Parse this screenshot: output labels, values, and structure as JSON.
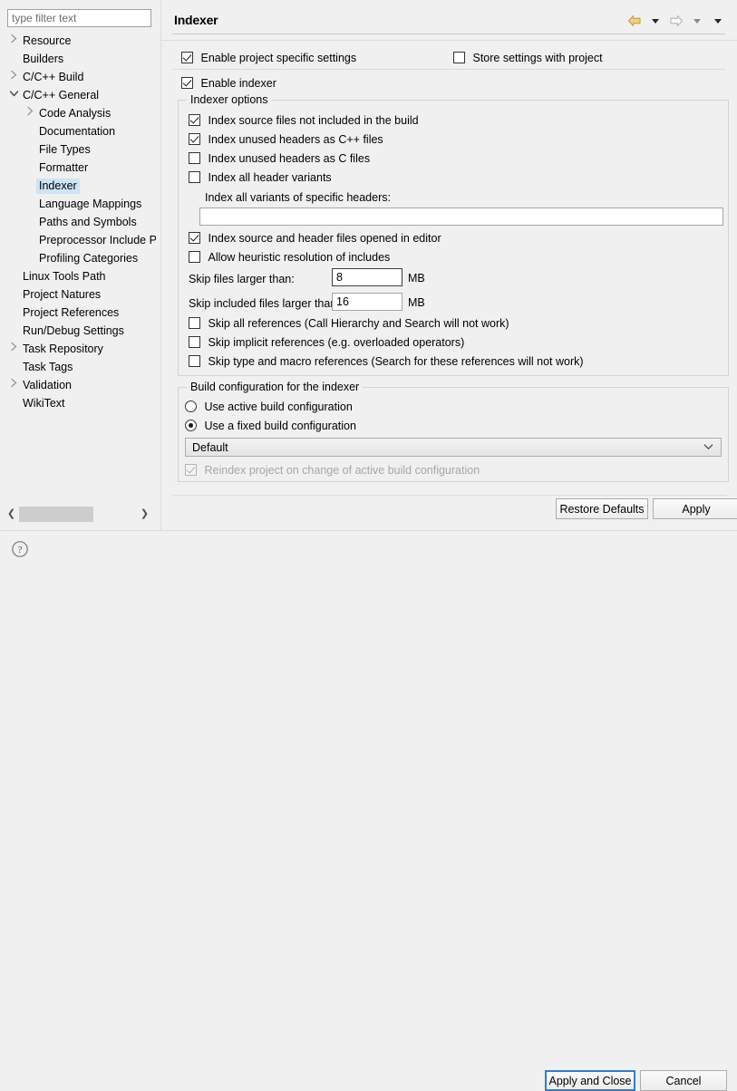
{
  "window": {
    "title": "Indexer"
  },
  "sidebar": {
    "filter": {
      "placeholder": "type filter text",
      "value": ""
    },
    "items": [
      {
        "label": "Resource",
        "level": 0,
        "twisty": "collapsed",
        "selected": false
      },
      {
        "label": "Builders",
        "level": 0,
        "twisty": "none",
        "selected": false
      },
      {
        "label": "C/C++ Build",
        "level": 0,
        "twisty": "collapsed",
        "selected": false
      },
      {
        "label": "C/C++ General",
        "level": 0,
        "twisty": "expanded",
        "selected": false
      },
      {
        "label": "Code Analysis",
        "level": 1,
        "twisty": "collapsed",
        "selected": false
      },
      {
        "label": "Documentation",
        "level": 1,
        "twisty": "none",
        "selected": false
      },
      {
        "label": "File Types",
        "level": 1,
        "twisty": "none",
        "selected": false
      },
      {
        "label": "Formatter",
        "level": 1,
        "twisty": "none",
        "selected": false
      },
      {
        "label": "Indexer",
        "level": 1,
        "twisty": "none",
        "selected": true
      },
      {
        "label": "Language Mappings",
        "level": 1,
        "twisty": "none",
        "selected": false
      },
      {
        "label": "Paths and Symbols",
        "level": 1,
        "twisty": "none",
        "selected": false
      },
      {
        "label": "Preprocessor Include Pat",
        "level": 1,
        "twisty": "none",
        "selected": false
      },
      {
        "label": "Profiling Categories",
        "level": 1,
        "twisty": "none",
        "selected": false
      },
      {
        "label": "Linux Tools Path",
        "level": 0,
        "twisty": "none",
        "selected": false
      },
      {
        "label": "Project Natures",
        "level": 0,
        "twisty": "none",
        "selected": false
      },
      {
        "label": "Project References",
        "level": 0,
        "twisty": "none",
        "selected": false
      },
      {
        "label": "Run/Debug Settings",
        "level": 0,
        "twisty": "none",
        "selected": false
      },
      {
        "label": "Task Repository",
        "level": 0,
        "twisty": "collapsed",
        "selected": false
      },
      {
        "label": "Task Tags",
        "level": 0,
        "twisty": "none",
        "selected": false
      },
      {
        "label": "Validation",
        "level": 0,
        "twisty": "collapsed",
        "selected": false
      },
      {
        "label": "WikiText",
        "level": 0,
        "twisty": "none",
        "selected": false
      }
    ],
    "scrollbar": {
      "left_arrow": "❮",
      "right_arrow": "❯"
    }
  },
  "header": {
    "title": "Indexer",
    "back_icon": "back-arrow-icon",
    "forward_icon": "forward-arrow-icon",
    "menu_icon": "chevron-down-icon"
  },
  "top_options": {
    "enable_project_specific": {
      "label": "Enable project specific settings",
      "checked": true
    },
    "store_with_project": {
      "label": "Store settings with project",
      "checked": false
    },
    "enable_indexer": {
      "label": "Enable indexer",
      "checked": true
    }
  },
  "indexer_options": {
    "group_title": "Indexer options",
    "checkboxes": [
      {
        "label": "Index source files not included in the build",
        "checked": true
      },
      {
        "label": "Index unused headers as C++ files",
        "checked": true
      },
      {
        "label": "Index unused headers as C files",
        "checked": false
      },
      {
        "label": "Index all header variants",
        "checked": false
      }
    ],
    "variants_label": "Index all variants of specific headers:",
    "variants_value": "",
    "checkboxes2": [
      {
        "label": "Index source and header files opened in editor",
        "checked": true
      },
      {
        "label": "Allow heuristic resolution of includes",
        "checked": false
      }
    ],
    "skip_files": {
      "label": "Skip files larger than:",
      "value": "8",
      "unit": "MB"
    },
    "skip_included": {
      "label": "Skip included files larger than:",
      "value": "16",
      "unit": "MB"
    },
    "checkboxes3": [
      {
        "label": "Skip all references (Call Hierarchy and Search will not work)",
        "checked": false
      },
      {
        "label": "Skip implicit references (e.g. overloaded operators)",
        "checked": false
      },
      {
        "label": "Skip type and macro references (Search for these references will not work)",
        "checked": false
      }
    ]
  },
  "build_config": {
    "group_title": "Build configuration for the indexer",
    "radios": [
      {
        "label": "Use active build configuration",
        "checked": false
      },
      {
        "label": "Use a fixed build configuration",
        "checked": true
      }
    ],
    "combo_value": "Default",
    "combo_arrow": "⌄",
    "reindex": {
      "label": "Reindex project on change of active build configuration",
      "checked": true,
      "disabled": true
    }
  },
  "page_buttons": {
    "restore_defaults": "Restore Defaults",
    "apply": "Apply"
  },
  "dialog_buttons": {
    "help_icon": "help-icon",
    "apply_and_close": "Apply and Close",
    "cancel": "Cancel"
  },
  "colors": {
    "selection": "#cde3f7",
    "focus_border": "#2b7fd4",
    "back_arrow": "#e8c25a",
    "background": "#f0f0f0"
  }
}
